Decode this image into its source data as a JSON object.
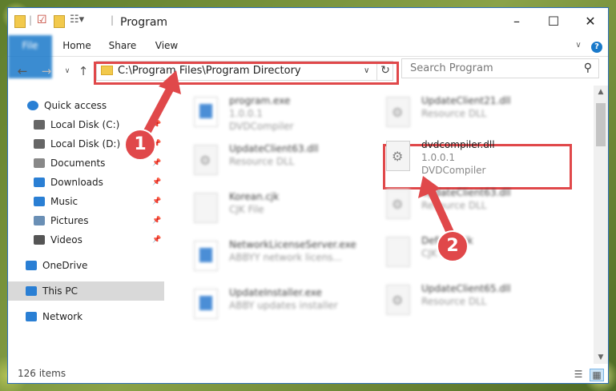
{
  "window": {
    "title": "Program"
  },
  "ribbon": {
    "tabs": [
      "File",
      "Home",
      "Share",
      "View"
    ]
  },
  "address": {
    "path": "C:\\Program Files\\Program Directory"
  },
  "search": {
    "placeholder": "Search Program"
  },
  "nav": {
    "items": [
      {
        "label": "Quick access",
        "icon": "star-icon",
        "pinned": false,
        "selected": false
      },
      {
        "label": "Local Disk (C:)",
        "icon": "drive-icon",
        "pinned": true,
        "selected": false
      },
      {
        "label": "Local Disk (D:)",
        "icon": "drive-icon",
        "pinned": true,
        "selected": false
      },
      {
        "label": "Documents",
        "icon": "documents-icon",
        "pinned": true,
        "selected": false
      },
      {
        "label": "Downloads",
        "icon": "download-icon",
        "pinned": true,
        "selected": false
      },
      {
        "label": "Music",
        "icon": "music-icon",
        "pinned": true,
        "selected": false
      },
      {
        "label": "Pictures",
        "icon": "pictures-icon",
        "pinned": true,
        "selected": false
      },
      {
        "label": "Videos",
        "icon": "videos-icon",
        "pinned": true,
        "selected": false
      },
      {
        "label": "OneDrive",
        "icon": "cloud-icon",
        "pinned": false,
        "selected": false
      },
      {
        "label": "This PC",
        "icon": "pc-icon",
        "pinned": false,
        "selected": true
      },
      {
        "label": "Network",
        "icon": "network-icon",
        "pinned": false,
        "selected": false
      }
    ]
  },
  "files": [
    {
      "name": "program.exe",
      "line2": "1.0.0.1",
      "line3": "DVDCompiler",
      "icon": "exe"
    },
    {
      "name": "UpdateClient21.dll",
      "line2": "Resource DLL",
      "line3": "",
      "icon": "gear"
    },
    {
      "name": "UpdateClient63.dll",
      "line2": "Resource DLL",
      "line3": "",
      "icon": "gear"
    },
    {
      "name": "dvdcompiler.dll",
      "line2": "1.0.0.1",
      "line3": "DVDCompiler",
      "icon": "gear"
    },
    {
      "name": "Korean.cjk",
      "line2": "CJK File",
      "line3": "",
      "icon": "doc"
    },
    {
      "name": "UpdateClient63.dll",
      "line2": "Resource DLL",
      "line3": "",
      "icon": "gear"
    },
    {
      "name": "NetworkLicenseServer.exe",
      "line2": "ABBYY network licens...",
      "line3": "",
      "icon": "exe"
    },
    {
      "name": "Default.cjk",
      "line2": "CJK File",
      "line3": "",
      "icon": "doc"
    },
    {
      "name": "UpdateInstaller.exe",
      "line2": "ABBY updates installer",
      "line3": "",
      "icon": "exe"
    },
    {
      "name": "UpdateClient65.dll",
      "line2": "Resource DLL",
      "line3": "",
      "icon": "gear"
    }
  ],
  "status": {
    "count": "126 items"
  },
  "callouts": {
    "one": "1",
    "two": "2"
  },
  "colors": {
    "accent": "#1979ca",
    "highlight": "#e0484a"
  }
}
